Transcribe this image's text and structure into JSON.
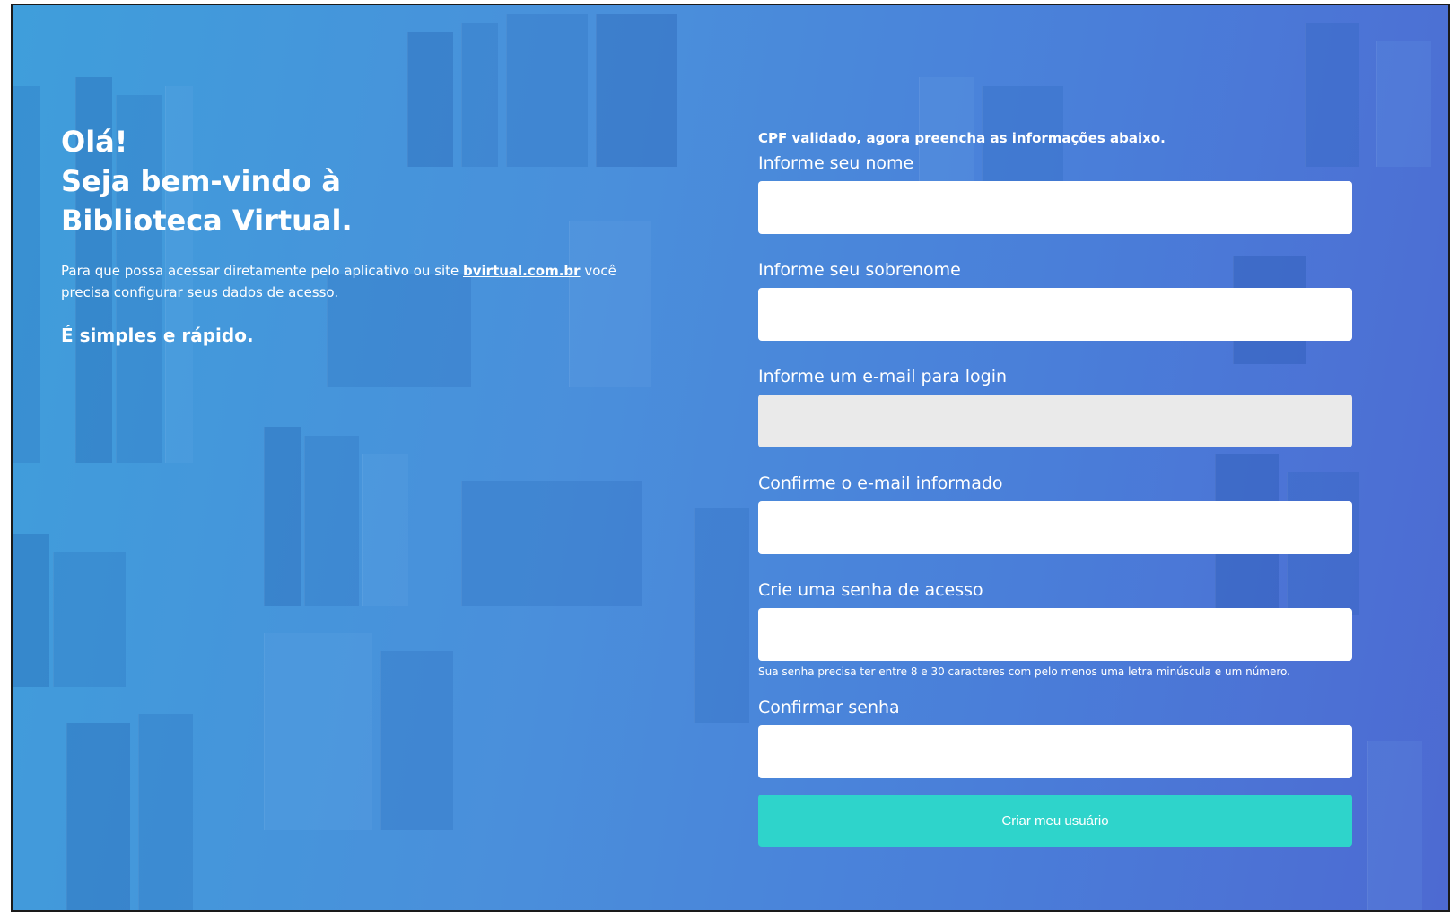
{
  "welcome": {
    "greeting": "Olá!",
    "line2": "Seja bem-vindo à",
    "line3": "Biblioteca Virtual.",
    "intro_before": "Para que possa acessar diretamente pelo aplicativo ou site ",
    "intro_link": "bvirtual.com.br",
    "intro_after": " você precisa configurar seus dados de acesso.",
    "tagline": "É simples e rápido."
  },
  "form": {
    "notice": "CPF validado, agora preencha as informações abaixo.",
    "fields": [
      {
        "label": "Informe seu nome",
        "value": "",
        "disabled": false
      },
      {
        "label": "Informe seu sobrenome",
        "value": "",
        "disabled": false
      },
      {
        "label": "Informe um e-mail para login",
        "value": "",
        "disabled": true
      },
      {
        "label": "Confirme o e-mail informado",
        "value": "",
        "disabled": false
      },
      {
        "label": "Crie uma senha de acesso",
        "value": "",
        "disabled": false
      },
      {
        "label": "Confirmar senha",
        "value": "",
        "disabled": false
      }
    ],
    "password_hint": "Sua senha precisa ter entre 8 e 30 caracteres com pelo menos uma letra minúscula e um número.",
    "submit_label": "Criar meu usuário"
  },
  "colors": {
    "background_start": "#3f9edb",
    "background_end": "#4d6ad2",
    "submit_button": "#2ed4cb",
    "disabled_field": "#eaeaea"
  }
}
